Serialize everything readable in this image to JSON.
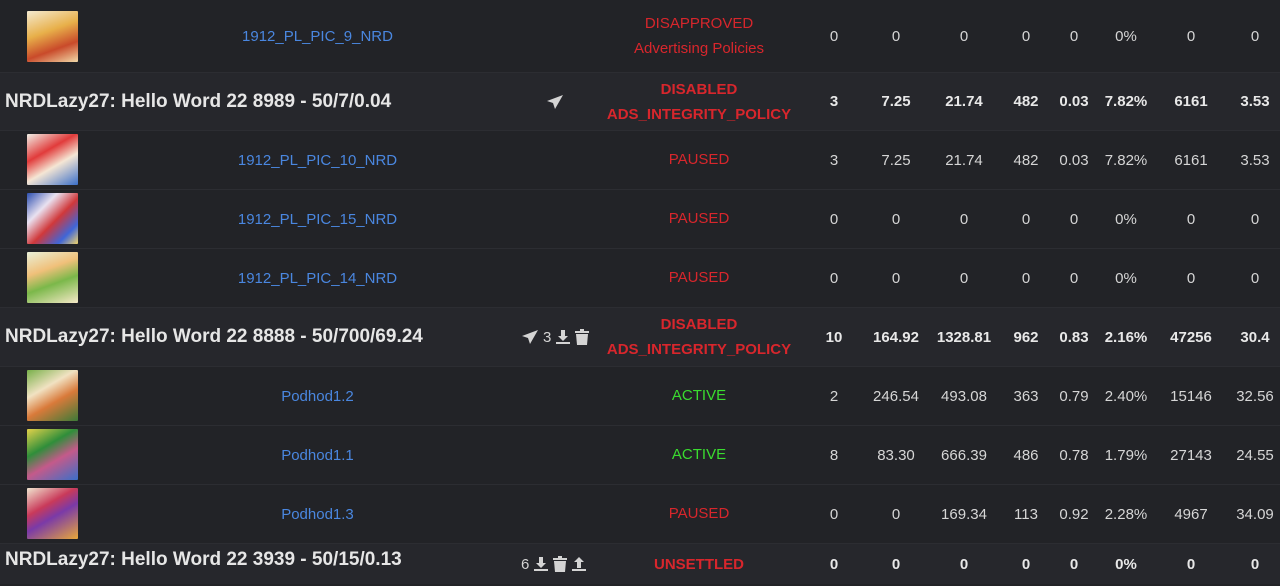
{
  "colors": {
    "background": "#222327",
    "campaign_row": "#26272c",
    "link": "#4a87e0",
    "status_red": "#d8262c",
    "status_green": "#3adc2f"
  },
  "rows": [
    {
      "type": "ad",
      "name": "1912_PL_PIC_9_NRD",
      "status_line1": "DISAPPROVED",
      "status_line2": "Advertising Policies",
      "status_color": "red",
      "metrics": [
        "0",
        "0",
        "0",
        "0",
        "0",
        "0%",
        "0",
        "0"
      ]
    },
    {
      "type": "campaign",
      "name": "NRDLazy27: Hello Word 22 8989 - 50/7/0.04",
      "status_line1": "DISABLED",
      "status_line2": "ADS_INTEGRITY_POLICY",
      "status_color": "red",
      "icons": [
        "send-icon"
      ],
      "icon_count": "",
      "metrics": [
        "3",
        "7.25",
        "21.74",
        "482",
        "0.03",
        "7.82%",
        "6161",
        "3.53"
      ]
    },
    {
      "type": "ad",
      "name": "1912_PL_PIC_10_NRD",
      "status_line1": "PAUSED",
      "status_color": "red",
      "metrics": [
        "3",
        "7.25",
        "21.74",
        "482",
        "0.03",
        "7.82%",
        "6161",
        "3.53"
      ]
    },
    {
      "type": "ad",
      "name": "1912_PL_PIC_15_NRD",
      "status_line1": "PAUSED",
      "status_color": "red",
      "metrics": [
        "0",
        "0",
        "0",
        "0",
        "0",
        "0%",
        "0",
        "0"
      ]
    },
    {
      "type": "ad",
      "name": "1912_PL_PIC_14_NRD",
      "status_line1": "PAUSED",
      "status_color": "red",
      "metrics": [
        "0",
        "0",
        "0",
        "0",
        "0",
        "0%",
        "0",
        "0"
      ]
    },
    {
      "type": "campaign",
      "name": "NRDLazy27: Hello Word 22 8888 - 50/700/69.24",
      "status_line1": "DISABLED",
      "status_line2": "ADS_INTEGRITY_POLICY",
      "status_color": "red",
      "icons": [
        "send-icon",
        "download-icon",
        "trash-icon"
      ],
      "icon_count": "3",
      "metrics": [
        "10",
        "164.92",
        "1328.81",
        "962",
        "0.83",
        "2.16%",
        "47256",
        "30.4"
      ]
    },
    {
      "type": "ad",
      "name": "Podhod1.2",
      "status_line1": "ACTIVE",
      "status_color": "green",
      "metrics": [
        "2",
        "246.54",
        "493.08",
        "363",
        "0.79",
        "2.40%",
        "15146",
        "32.56"
      ]
    },
    {
      "type": "ad",
      "name": "Podhod1.1",
      "status_line1": "ACTIVE",
      "status_color": "green",
      "metrics": [
        "8",
        "83.30",
        "666.39",
        "486",
        "0.78",
        "1.79%",
        "27143",
        "24.55"
      ]
    },
    {
      "type": "ad",
      "name": "Podhod1.3",
      "status_line1": "PAUSED",
      "status_color": "red",
      "metrics": [
        "0",
        "0",
        "169.34",
        "113",
        "0.92",
        "2.28%",
        "4967",
        "34.09"
      ]
    },
    {
      "type": "campaign",
      "name": "NRDLazy27: Hello Word 22 3939 - 50/15/0.13",
      "status_line1": "UNSETTLED",
      "status_color": "red",
      "icons": [
        "download-icon",
        "trash-icon",
        "upload-icon"
      ],
      "icon_count": "6",
      "metrics": [
        "0",
        "0",
        "0",
        "0",
        "0",
        "0%",
        "0",
        "0"
      ]
    }
  ]
}
